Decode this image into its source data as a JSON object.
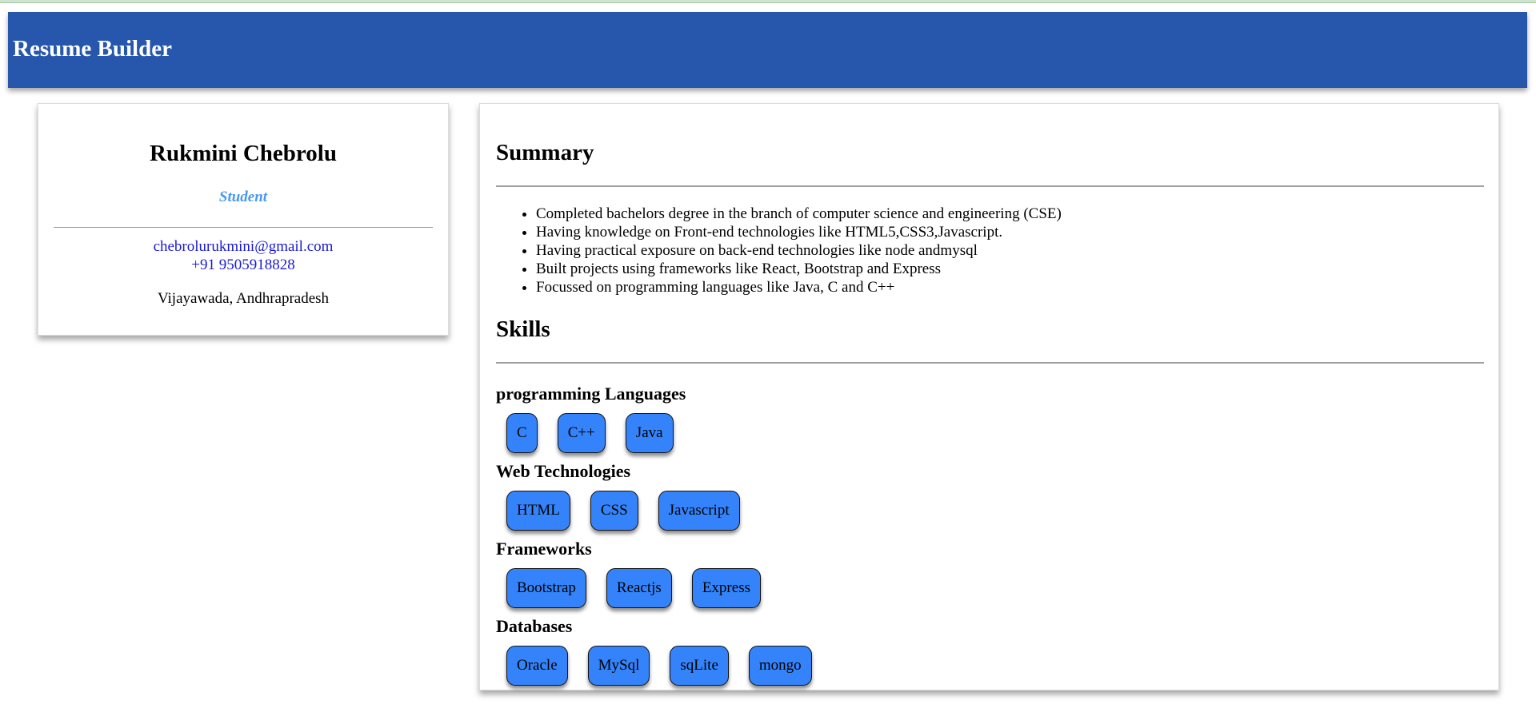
{
  "app": {
    "title": "Resume Builder",
    "header_color": "#2757ad"
  },
  "profile": {
    "name": "Rukmini Chebrolu",
    "role": "Student",
    "email": "chebrolurukmini@gmail.com",
    "phone": "+91 9505918828",
    "location": "Vijayawada, Andhrapradesh"
  },
  "summary": {
    "heading": "Summary",
    "items": [
      "Completed bachelors degree in the branch of computer science and engineering (CSE)",
      "Having knowledge on Front-end technologies like HTML5,CSS3,Javascript.",
      "Having practical exposure on back-end technologies like node andmysql",
      "Built projects using frameworks like React, Bootstrap and Express",
      "Focussed on programming languages like Java, C and C++"
    ]
  },
  "skills": {
    "heading": "Skills",
    "chip_color": "#3483fa",
    "groups": [
      {
        "title": "programming Languages",
        "items": [
          "C",
          "C++",
          "Java"
        ]
      },
      {
        "title": "Web Technologies",
        "items": [
          "HTML",
          "CSS",
          "Javascript"
        ]
      },
      {
        "title": "Frameworks",
        "items": [
          "Bootstrap",
          "Reactjs",
          "Express"
        ]
      },
      {
        "title": "Databases",
        "items": [
          "Oracle",
          "MySql",
          "sqLite",
          "mongo"
        ]
      }
    ]
  }
}
